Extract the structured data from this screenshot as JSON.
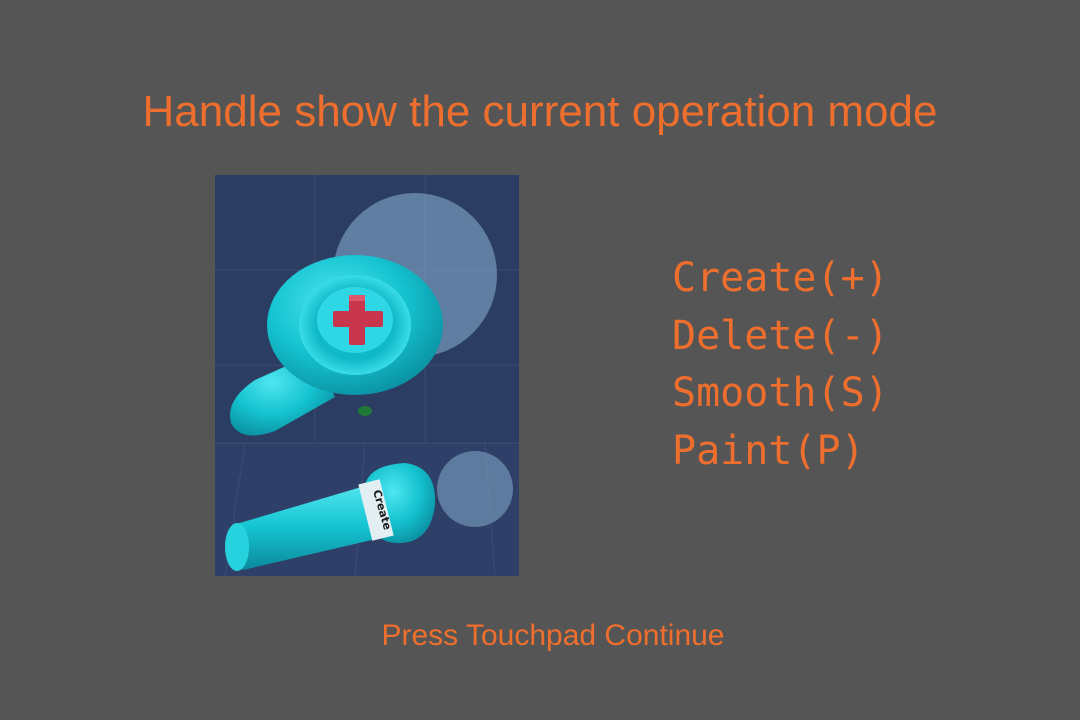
{
  "screen": {
    "title": "Handle show the current operation mode",
    "hint": "Press Touchpad Continue"
  },
  "preview": {
    "controller_label": "Create",
    "icons": {
      "top": "plus-icon"
    },
    "colors": {
      "background": "#2c3d64",
      "handle": "#13c4d0",
      "plus": "#c8364e",
      "bubble": "#8ab5d3"
    }
  },
  "modes": [
    {
      "label": "Create(+)"
    },
    {
      "label": "Delete(-)"
    },
    {
      "label": "Smooth(S)"
    },
    {
      "label": "Paint(P)"
    }
  ],
  "colors": {
    "page_background": "#555555",
    "text": "#ee6f2d"
  }
}
